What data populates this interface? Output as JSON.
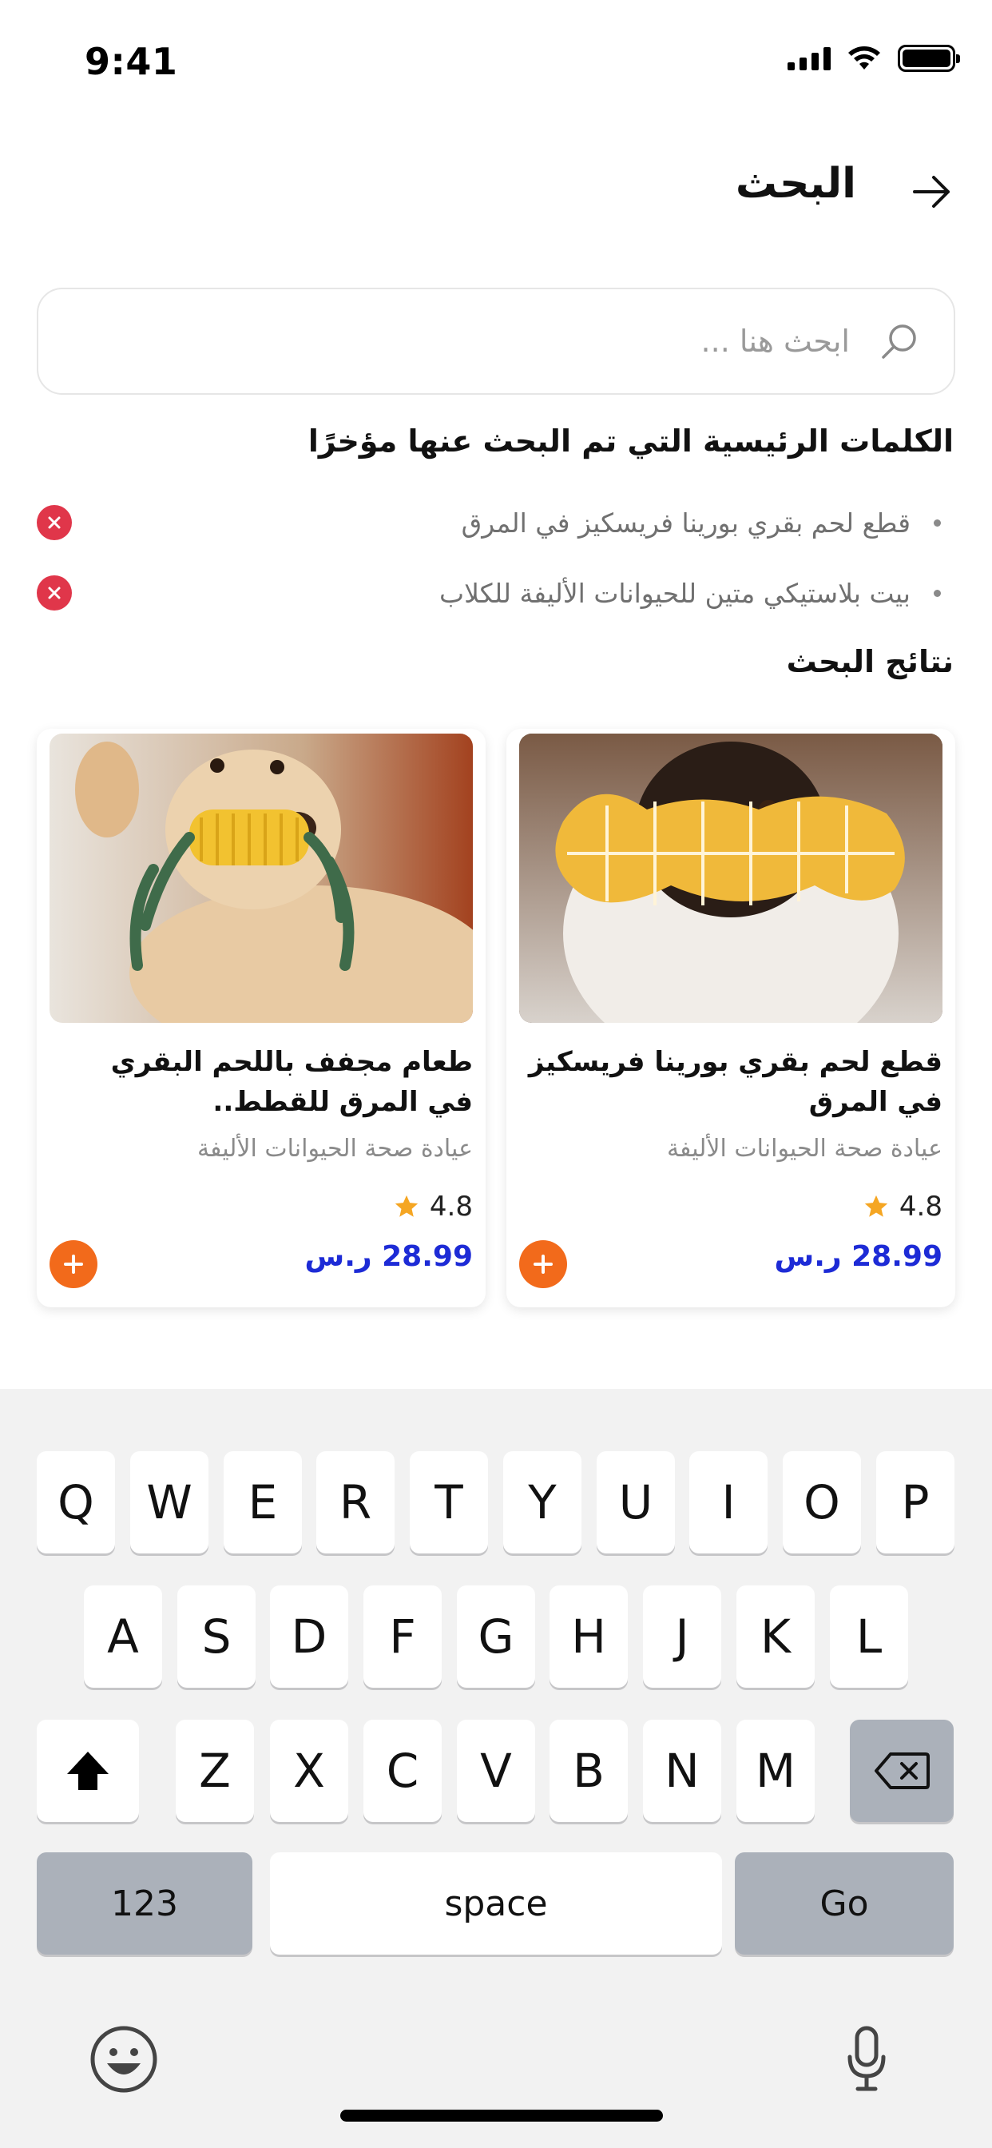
{
  "status_bar": {
    "time": "9:41"
  },
  "header": {
    "title": "البحث"
  },
  "search": {
    "placeholder": "ابحث هنا ...",
    "value": ""
  },
  "recent": {
    "title": "الكلمات الرئيسية التي تم البحث عنها مؤخرًا",
    "items": [
      {
        "text": "قطع لحم بقري بورينا فريسكيز في المرق"
      },
      {
        "text": "بيت بلاستيكي متين للحيوانات الأليفة للكلاب"
      }
    ]
  },
  "results": {
    "title": "نتائج البحث",
    "products": [
      {
        "title": "قطع لحم بقري بورينا فريسكيز في المرق",
        "brand": "عيادة صحة الحيوانات الأليفة",
        "rating": "4.8",
        "price": "28.99 ر.س",
        "image_icon": "dog-with-bone-toy"
      },
      {
        "title": "طعام مجفف باللحم البقري في المرق للقطط..",
        "brand": "عيادة صحة الحيوانات الأليفة",
        "rating": "4.8",
        "price": "28.99 ر.س",
        "image_icon": "dog-with-corn-toy"
      }
    ]
  },
  "keyboard": {
    "row1": [
      "Q",
      "W",
      "E",
      "R",
      "T",
      "Y",
      "U",
      "I",
      "O",
      "P"
    ],
    "row2": [
      "A",
      "S",
      "D",
      "F",
      "G",
      "H",
      "J",
      "K",
      "L"
    ],
    "row3": [
      "Z",
      "X",
      "C",
      "V",
      "B",
      "N",
      "M"
    ],
    "numbers_label": "123",
    "space_label": "space",
    "go_label": "Go"
  },
  "colors": {
    "accent_orange": "#f26a1b",
    "price_blue": "#1d2bd6",
    "remove_red": "#e0364a",
    "star": "#f5a623"
  }
}
